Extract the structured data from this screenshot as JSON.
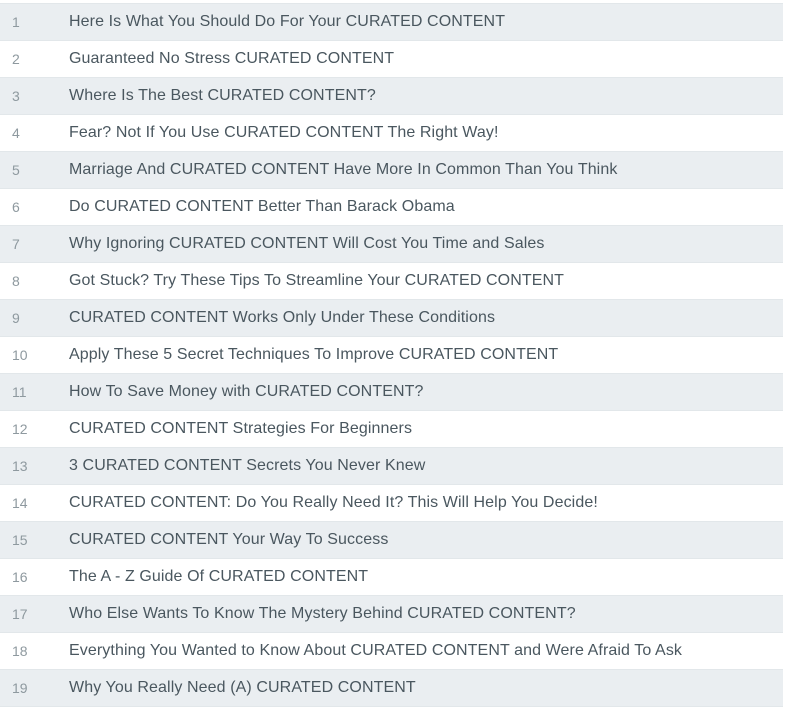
{
  "list": {
    "name": "curated-content-headline-ideas",
    "colors": {
      "row_shaded_background": "#eaeef1",
      "row_plain_background": "#ffffff",
      "row_divider": "#e2e7ea",
      "title_text": "#4a575f",
      "index_text": "#8e999f"
    },
    "items": [
      {
        "index": "1",
        "title": "Here Is What You Should Do For Your CURATED CONTENT"
      },
      {
        "index": "2",
        "title": "Guaranteed No Stress CURATED CONTENT"
      },
      {
        "index": "3",
        "title": "Where Is The Best CURATED CONTENT?"
      },
      {
        "index": "4",
        "title": "Fear? Not If You Use CURATED CONTENT The Right Way!"
      },
      {
        "index": "5",
        "title": "Marriage And CURATED CONTENT Have More In Common Than You Think"
      },
      {
        "index": "6",
        "title": "Do CURATED CONTENT Better Than Barack Obama"
      },
      {
        "index": "7",
        "title": "Why Ignoring CURATED CONTENT Will Cost You Time and Sales"
      },
      {
        "index": "8",
        "title": "Got Stuck? Try These Tips To Streamline Your CURATED CONTENT"
      },
      {
        "index": "9",
        "title": "CURATED CONTENT Works Only Under These Conditions"
      },
      {
        "index": "10",
        "title": "Apply These 5 Secret Techniques To Improve CURATED CONTENT"
      },
      {
        "index": "11",
        "title": "How To Save Money with CURATED CONTENT?"
      },
      {
        "index": "12",
        "title": "CURATED CONTENT Strategies For Beginners"
      },
      {
        "index": "13",
        "title": "3 CURATED CONTENT Secrets You Never Knew"
      },
      {
        "index": "14",
        "title": "CURATED CONTENT: Do You Really Need It? This Will Help You Decide!"
      },
      {
        "index": "15",
        "title": "CURATED CONTENT Your Way To Success"
      },
      {
        "index": "16",
        "title": "The A - Z Guide Of CURATED CONTENT"
      },
      {
        "index": "17",
        "title": "Who Else Wants To Know The Mystery Behind CURATED CONTENT?"
      },
      {
        "index": "18",
        "title": "Everything You Wanted to Know About CURATED CONTENT and Were Afraid To Ask"
      },
      {
        "index": "19",
        "title": "Why You Really Need (A) CURATED CONTENT"
      }
    ]
  }
}
